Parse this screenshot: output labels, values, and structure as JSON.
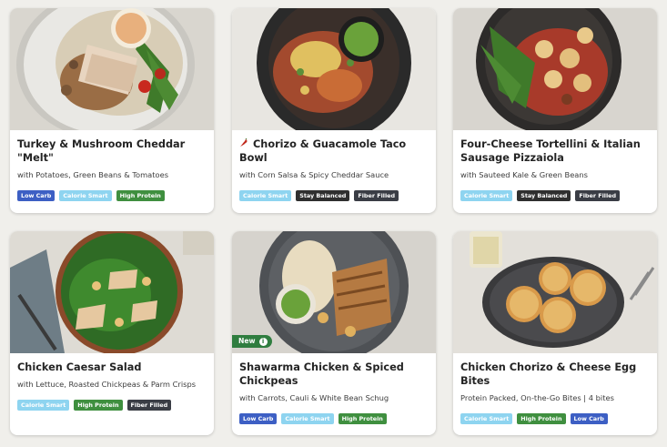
{
  "tag_colors": {
    "low_carb": "#3d5fc4",
    "calorie_smart": "#8ed4f0",
    "high_protein": "#3f8f3f",
    "stay_balanced": "#2f2f2f",
    "fiber_filled": "#3a3d45"
  },
  "meals": [
    {
      "title": "Turkey & Mushroom Cheddar \"Melt\"",
      "subtitle": "with Potatoes, Green Beans & Tomatoes",
      "tags": [
        "Low Carb",
        "Calorie Smart",
        "High Protein"
      ]
    },
    {
      "title": "Chorizo & Guacamole Taco Bowl",
      "subtitle": "with Corn Salsa & Spicy Cheddar Sauce",
      "spicy_icon": "chili-pepper-icon",
      "tags": [
        "Calorie Smart",
        "Stay Balanced",
        "Fiber Filled"
      ]
    },
    {
      "title": "Four-Cheese Tortellini & Italian Sausage Pizzaiola",
      "subtitle": "with Sauteed Kale & Green Beans",
      "tags": [
        "Calorie Smart",
        "Stay Balanced",
        "Fiber Filled"
      ]
    },
    {
      "title": "Chicken Caesar Salad",
      "subtitle": "with Lettuce, Roasted Chickpeas & Parm Crisps",
      "tags": [
        "Calorie Smart",
        "High Protein",
        "Fiber Filled"
      ]
    },
    {
      "title": "Shawarma Chicken & Spiced Chickpeas",
      "subtitle": "with Carrots, Cauli & White Bean Schug",
      "badge": "New",
      "badge_icon": "info-icon",
      "tags": [
        "Low Carb",
        "Calorie Smart",
        "High Protein"
      ]
    },
    {
      "title": "Chicken Chorizo & Cheese Egg Bites",
      "subtitle": "Protein Packed, On-the-Go Bites | 4 bites",
      "tags": [
        "Calorie Smart",
        "High Protein",
        "Low Carb"
      ]
    }
  ]
}
